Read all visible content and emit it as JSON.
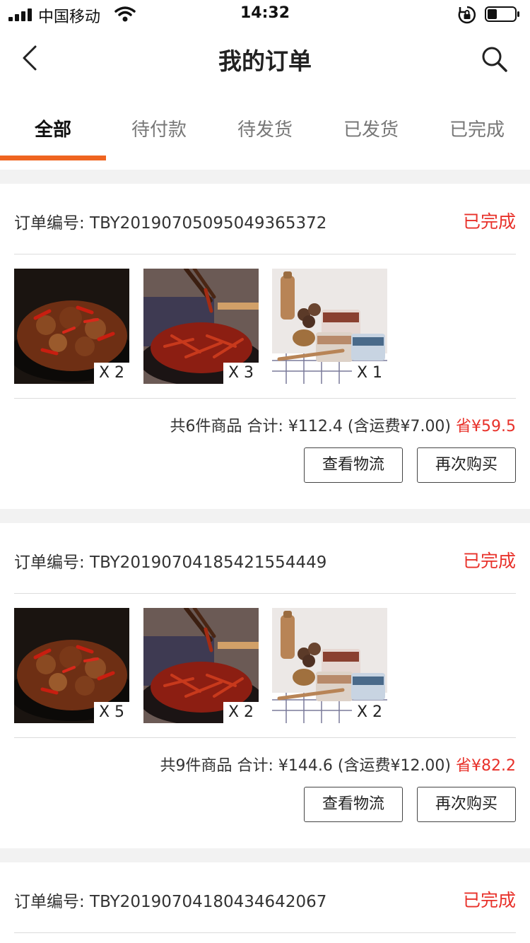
{
  "status_bar": {
    "carrier": "中国移动",
    "time": "14:32",
    "battery_percent": 35
  },
  "nav": {
    "title": "我的订单",
    "back_icon": "chevron-left-icon",
    "search_icon": "search-icon"
  },
  "tabs": [
    {
      "label": "全部",
      "active": true
    },
    {
      "label": "待付款",
      "active": false
    },
    {
      "label": "待发货",
      "active": false
    },
    {
      "label": "已发货",
      "active": false
    },
    {
      "label": "已完成",
      "active": false
    }
  ],
  "colors": {
    "accent": "#ef6420",
    "status_red": "#e8312a",
    "band": "#f2f2f2"
  },
  "orders": [
    {
      "order_no": "订单编号: TBY20190705095049365372",
      "status": "已完成",
      "items": [
        {
          "product": "spicy-beef",
          "qty": "X 2"
        },
        {
          "product": "spicy-shreds",
          "qty": "X 3"
        },
        {
          "product": "canned-sauce",
          "qty": "X 1"
        }
      ],
      "summary": "共6件商品 合计: ¥112.4 (含运费¥7.00)",
      "saving": "省¥59.5",
      "btn_logistics": "查看物流",
      "btn_rebuy": "再次购买"
    },
    {
      "order_no": "订单编号: TBY20190704185421554449",
      "status": "已完成",
      "items": [
        {
          "product": "spicy-beef",
          "qty": "X 5"
        },
        {
          "product": "spicy-shreds",
          "qty": "X 2"
        },
        {
          "product": "canned-sauce",
          "qty": "X 2"
        }
      ],
      "summary": "共9件商品 合计: ¥144.6 (含运费¥12.00)",
      "saving": "省¥82.2",
      "btn_logistics": "查看物流",
      "btn_rebuy": "再次购买"
    },
    {
      "order_no": "订单编号: TBY20190704180434642067",
      "status": "已完成"
    }
  ]
}
